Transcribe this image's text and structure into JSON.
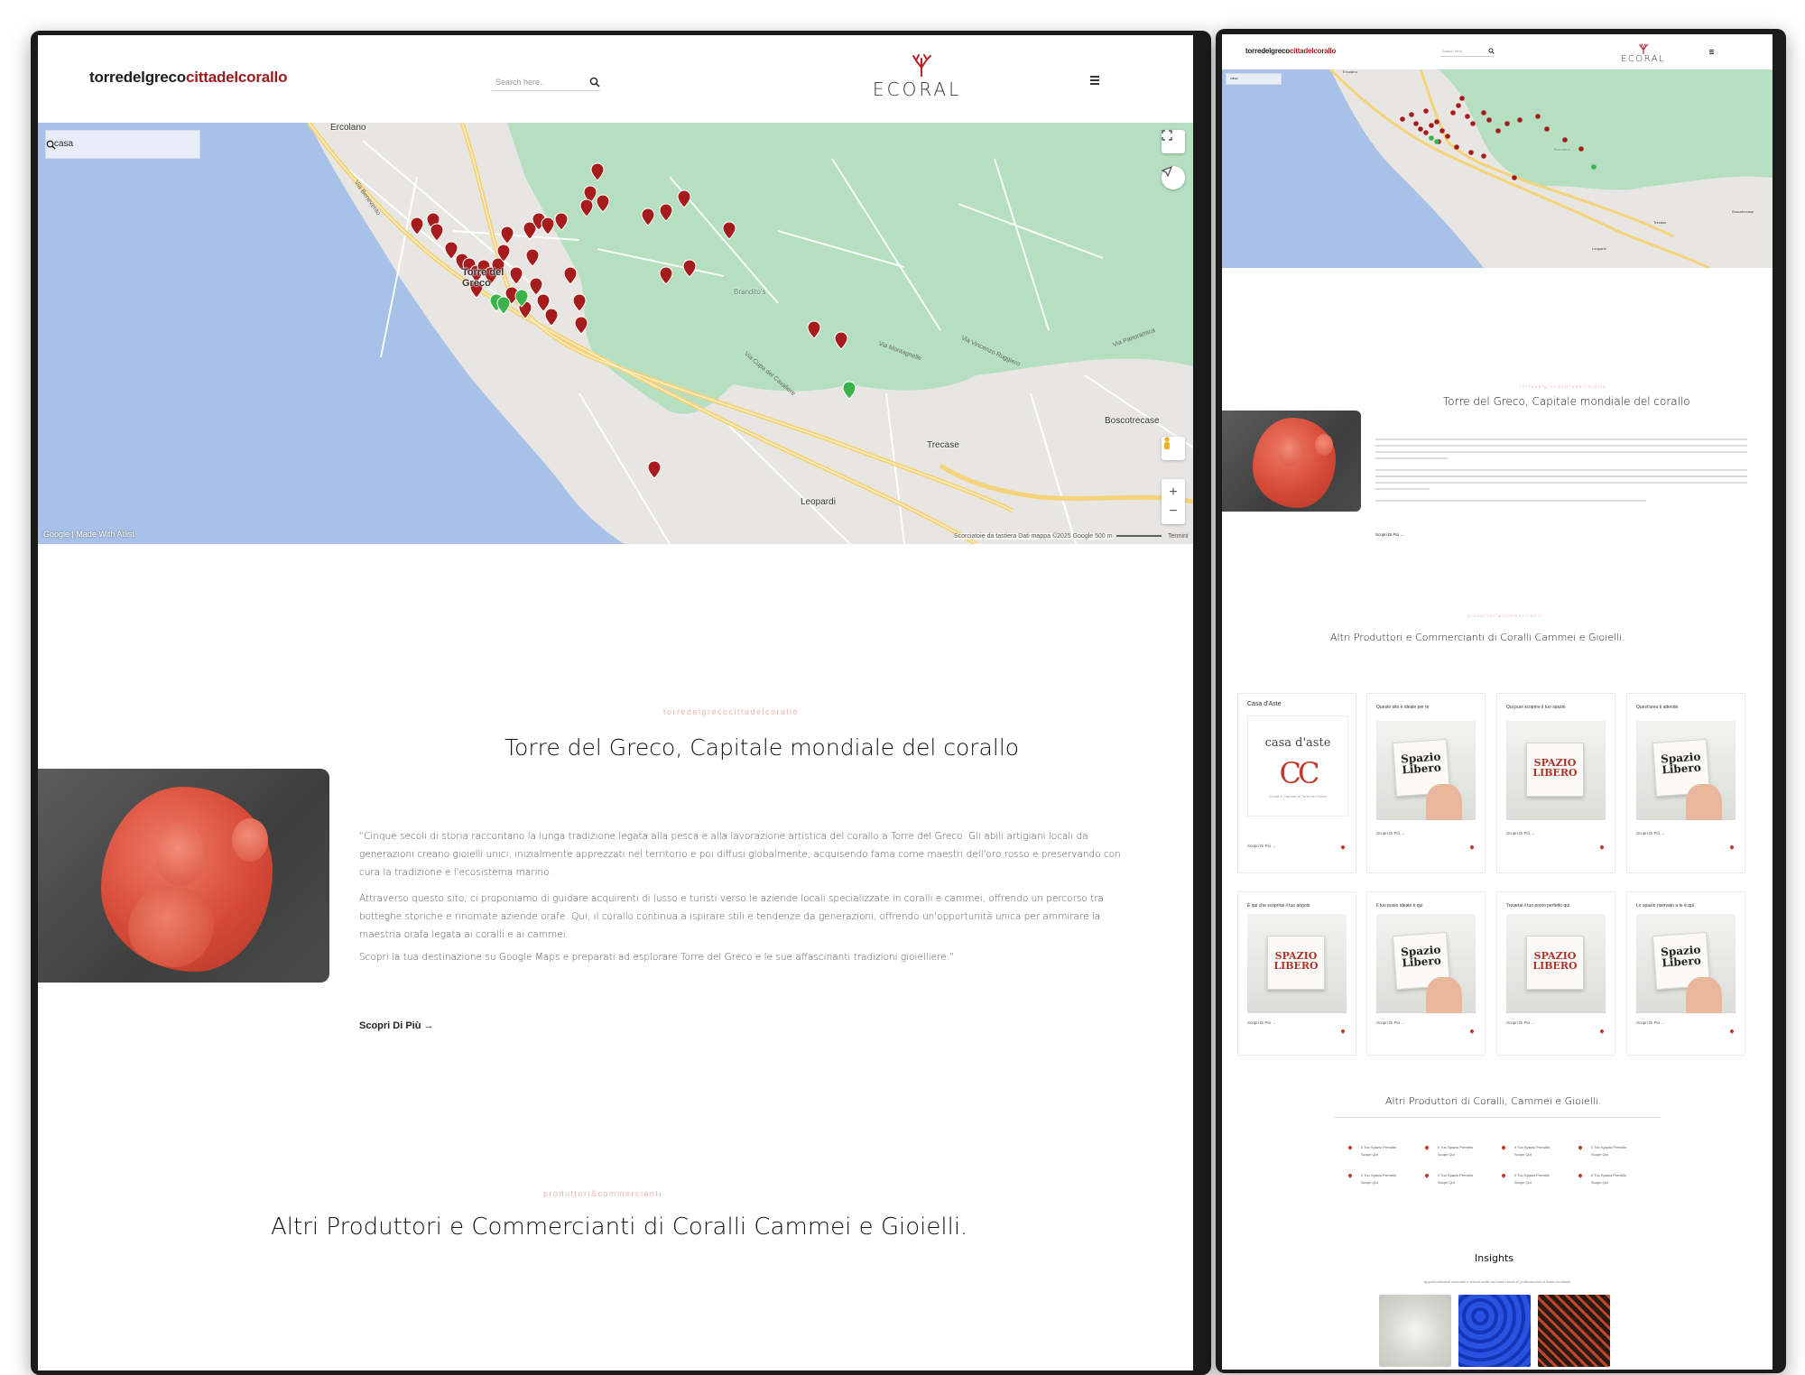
{
  "left": {
    "header": {
      "brand_part1": "torredelgreco",
      "brand_part2": "cittadelcorallo",
      "search_placeholder": "Search here..",
      "logo_text": "ECORAL"
    },
    "map": {
      "search_value": "casa",
      "places": [
        "Ercolano",
        "Torre del Greco",
        "Brandito's",
        "Boscotrecase",
        "Trecase",
        "Leopardi"
      ],
      "roads": [
        "Via Montagnelle",
        "Via Benevento",
        "Via Panoramica",
        "Via Cupa del Cavaliere",
        "Via Vincenzo Ruggiero"
      ],
      "attribution": "Google | Made With Atlist",
      "footer": "Scorciatoie da tastiera   Dati mappa ©2025 Google   500 m",
      "terms": "Termini"
    },
    "intro": {
      "eyebrow": "torredelgrecocittadelcorallo",
      "title": "Torre del Greco, Capitale mondiale del corallo",
      "paragraph1": "“Cinque secoli di storia raccontano la lunga tradizione legata alla pesca e alla lavorazione artistica del corallo a Torre del Greco. Gli abili artigiani locali da generazioni creano gioielli unici, inizialmente apprezzati nel territorio e poi diffusi globalmente, acquisendo fama come maestri dell'oro rosso e preservando con cura la tradizione e l'ecosistema marino.",
      "paragraph2": "Attraverso questo sito, ci proponiamo di guidare acquirenti di lusso e turisti verso le aziende locali specializzate in coralli e cammei, offrendo un percorso tra botteghe storiche e rinomate aziende orafe. Qui, il corallo continua a ispirare stili e tendenze da generazioni, offrendo un'opportunità unica per ammirare la maestria orafa legata ai coralli e ai cammei.",
      "paragraph3": "Scopri la tua destinazione su Google Maps e preparati ad esplorare Torre del Greco e le sue affascinanti tradizioni gioielliere.”",
      "more": "Scopri Di Più →"
    },
    "producers": {
      "eyebrow": "produttori&commercianti",
      "title": "Altri Produttori e Commercianti di Coralli Cammei e Gioielli."
    }
  },
  "right": {
    "header": {
      "brand_part1": "torredelgreco",
      "brand_part2": "cittadelcorallo",
      "search_placeholder": "Search here..",
      "logo_text": "ECORAL"
    },
    "map": {
      "search_value": "casa",
      "places": [
        "Ercolano",
        "Brandito's",
        "Boscotrecase",
        "Trecase",
        "Leopardi"
      ]
    },
    "intro": {
      "eyebrow": "torredelgrecocittadelcorallo",
      "title": "Torre del Greco, Capitale mondiale del corallo",
      "more": "Scopri Di Più →"
    },
    "producers": {
      "eyebrow": "produttori&commercianti",
      "title": "Altri Produttori e Commercianti di Coralli Cammei e Gioielli.",
      "cards": [
        {
          "caption": "Casa d'Aste",
          "badge1": "casa d'aste",
          "badge2": "CC",
          "badge3": "Coralli e Cammei di Torre del Greco",
          "link": "Scopri Di Più →"
        },
        {
          "caption": "Questo sito è ideale per te",
          "badge1": "Spazio",
          "badge2": "Libero",
          "link": "Scopri Di Più →"
        },
        {
          "caption": "Qui puoi scoprire il tuo spazio",
          "badge1": "SPAZIO",
          "badge2": "LIBERO",
          "link": "Scopri Di Più →"
        },
        {
          "caption": "Quest'area ti attende",
          "badge1": "Spazio",
          "badge2": "Libero",
          "link": "Scopri Di Più →"
        },
        {
          "caption": "È qui che scoprirai il tuo angolo",
          "badge1": "SPAZIO",
          "badge2": "LIBERO",
          "link": "Scopri Di Più →"
        },
        {
          "caption": "Il tuo posto ideale è qui",
          "badge1": "Spazio",
          "badge2": "Libero",
          "link": "Scopri Di Più →"
        },
        {
          "caption": "Troverai il tuo posto perfetto qui",
          "badge1": "SPAZIO",
          "badge2": "LIBERO",
          "link": "Scopri Di Più →"
        },
        {
          "caption": "Lo spazio riservato a te è qui",
          "badge1": "Spazio",
          "badge2": "Libero",
          "link": "Scopri Di Più →"
        }
      ]
    },
    "producers2": {
      "title": "Altri Produttori di Coralli, Cammei e Gioielli.",
      "items": [
        "Il Tuo Spazio Prendilo",
        "Il Tuo Spazio Prendilo",
        "Il Tuo Spazio Prendilo",
        "Il Tuo Spazio Prendilo",
        "Il Tuo Spazio Prendilo",
        "Il Tuo Spazio Prendilo",
        "Il Tuo Spazio Prendilo",
        "Il Tuo Spazio Prendilo"
      ],
      "item_sub": "Scopri Qui"
    },
    "insights": {
      "title": "Insights",
      "subtitle": "Approfondimenti aziendali e articoli scritti dal nostro team di professionisti di livello mondiale"
    }
  },
  "colors": {
    "brand_red": "#9a1b1f",
    "pin_red": "#a61c1c",
    "pin_green": "#3bb34a",
    "sea": "#a7c1e8",
    "park": "#b5dfc0",
    "eyebrow": "#e8b3b3"
  }
}
